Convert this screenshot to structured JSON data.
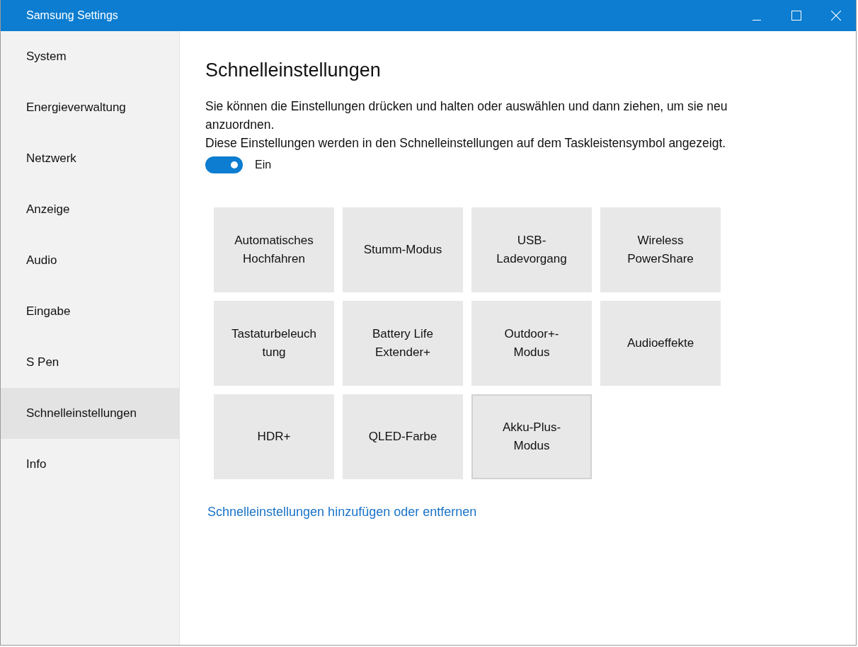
{
  "window": {
    "title": "Samsung Settings"
  },
  "sidebar": {
    "items": [
      {
        "label": "System",
        "selected": false
      },
      {
        "label": "Energieverwaltung",
        "selected": false
      },
      {
        "label": "Netzwerk",
        "selected": false
      },
      {
        "label": "Anzeige",
        "selected": false
      },
      {
        "label": "Audio",
        "selected": false
      },
      {
        "label": "Eingabe",
        "selected": false
      },
      {
        "label": "S Pen",
        "selected": false
      },
      {
        "label": "Schnelleinstellungen",
        "selected": true
      },
      {
        "label": "Info",
        "selected": false
      }
    ]
  },
  "content": {
    "heading": "Schnelleinstellungen",
    "description": [
      "Sie können die Einstellungen drücken und halten oder auswählen und dann ziehen, um sie neu anzuordnen.",
      "Diese Einstellungen werden in den Schnelleinstellungen auf dem Taskleistensymbol angezeigt."
    ],
    "toggle": {
      "on": true,
      "label": "Ein"
    },
    "tiles": [
      {
        "label": "Automatisches Hochfahren",
        "focused": false
      },
      {
        "label": "Stumm-Modus",
        "focused": false
      },
      {
        "label": "USB-Ladevorgang",
        "focused": false
      },
      {
        "label": "Wireless PowerShare",
        "focused": false
      },
      {
        "label": "Tastaturbeleuchtung",
        "focused": false
      },
      {
        "label": "Battery Life Extender+",
        "focused": false
      },
      {
        "label": "Outdoor+-Modus",
        "focused": false
      },
      {
        "label": "Audioeffekte",
        "focused": false
      },
      {
        "label": "HDR+",
        "focused": false
      },
      {
        "label": "QLED-Farbe",
        "focused": false
      },
      {
        "label": "Akku-Plus-Modus",
        "focused": true
      }
    ],
    "link": "Schnelleinstellungen hinzufügen oder entfernen"
  }
}
